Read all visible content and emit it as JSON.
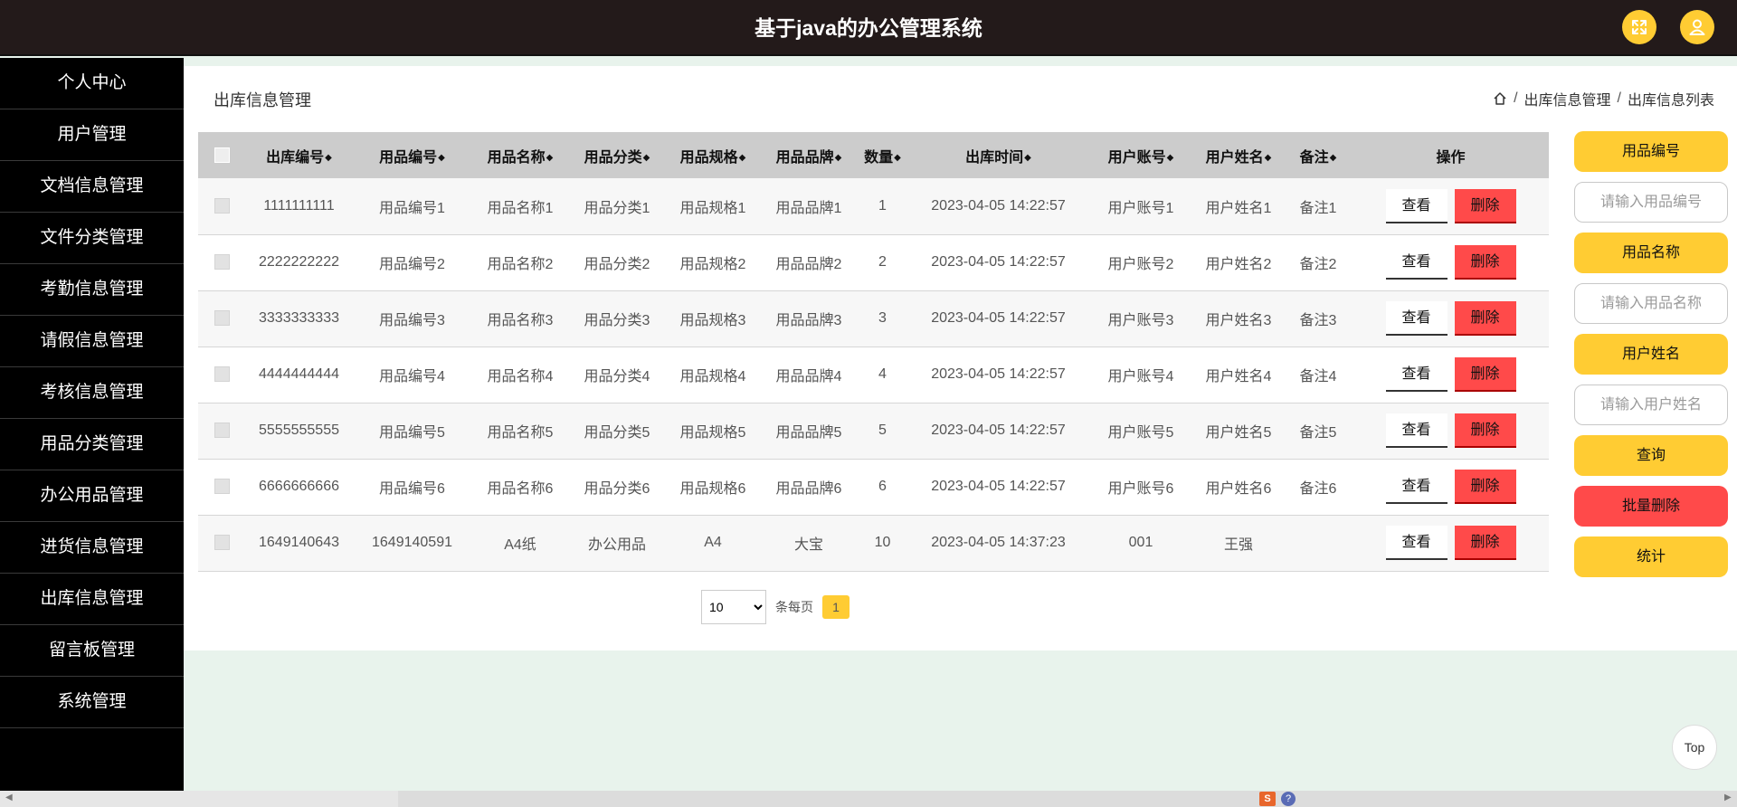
{
  "header": {
    "title": "基于java的办公管理系统"
  },
  "sidebar": {
    "items": [
      {
        "label": "个人中心"
      },
      {
        "label": "用户管理"
      },
      {
        "label": "文档信息管理"
      },
      {
        "label": "文件分类管理"
      },
      {
        "label": "考勤信息管理"
      },
      {
        "label": "请假信息管理"
      },
      {
        "label": "考核信息管理"
      },
      {
        "label": "用品分类管理"
      },
      {
        "label": "办公用品管理"
      },
      {
        "label": "进货信息管理"
      },
      {
        "label": "出库信息管理"
      },
      {
        "label": "留言板管理"
      },
      {
        "label": "系统管理"
      }
    ]
  },
  "main": {
    "page_title": "出库信息管理",
    "breadcrumb": [
      "出库信息管理",
      "出库信息列表"
    ]
  },
  "table": {
    "columns": [
      "出库编号",
      "用品编号",
      "用品名称",
      "用品分类",
      "用品规格",
      "用品品牌",
      "数量",
      "出库时间",
      "用户账号",
      "用户姓名",
      "备注",
      "操作"
    ],
    "view_label": "查看",
    "delete_label": "删除",
    "rows": [
      [
        "1111111111",
        "用品编号1",
        "用品名称1",
        "用品分类1",
        "用品规格1",
        "用品品牌1",
        "1",
        "2023-04-05 14:22:57",
        "用户账号1",
        "用户姓名1",
        "备注1"
      ],
      [
        "2222222222",
        "用品编号2",
        "用品名称2",
        "用品分类2",
        "用品规格2",
        "用品品牌2",
        "2",
        "2023-04-05 14:22:57",
        "用户账号2",
        "用户姓名2",
        "备注2"
      ],
      [
        "3333333333",
        "用品编号3",
        "用品名称3",
        "用品分类3",
        "用品规格3",
        "用品品牌3",
        "3",
        "2023-04-05 14:22:57",
        "用户账号3",
        "用户姓名3",
        "备注3"
      ],
      [
        "4444444444",
        "用品编号4",
        "用品名称4",
        "用品分类4",
        "用品规格4",
        "用品品牌4",
        "4",
        "2023-04-05 14:22:57",
        "用户账号4",
        "用户姓名4",
        "备注4"
      ],
      [
        "5555555555",
        "用品编号5",
        "用品名称5",
        "用品分类5",
        "用品规格5",
        "用品品牌5",
        "5",
        "2023-04-05 14:22:57",
        "用户账号5",
        "用户姓名5",
        "备注5"
      ],
      [
        "6666666666",
        "用品编号6",
        "用品名称6",
        "用品分类6",
        "用品规格6",
        "用品品牌6",
        "6",
        "2023-04-05 14:22:57",
        "用户账号6",
        "用户姓名6",
        "备注6"
      ],
      [
        "1649140643",
        "1649140591",
        "A4纸",
        "办公用品",
        "A4",
        "大宝",
        "10",
        "2023-04-05 14:37:23",
        "001",
        "王强",
        ""
      ]
    ]
  },
  "pagination": {
    "page_size": "10",
    "per_page_label": "条每页",
    "current_page": "1"
  },
  "search": {
    "field1_label": "用品编号",
    "field1_placeholder": "请输入用品编号",
    "field2_label": "用品名称",
    "field2_placeholder": "请输入用品名称",
    "field3_label": "用户姓名",
    "field3_placeholder": "请输入用户姓名",
    "query_label": "查询",
    "batch_delete_label": "批量删除",
    "stats_label": "统计"
  },
  "top_button": "Top",
  "icons": {
    "expand": "expand-icon",
    "user": "user-icon",
    "home": "home-icon"
  },
  "colors": {
    "accent": "#ffcc33",
    "danger": "#ff4a4a",
    "header_bg": "#231a1a",
    "sidebar_bg": "#000000"
  }
}
